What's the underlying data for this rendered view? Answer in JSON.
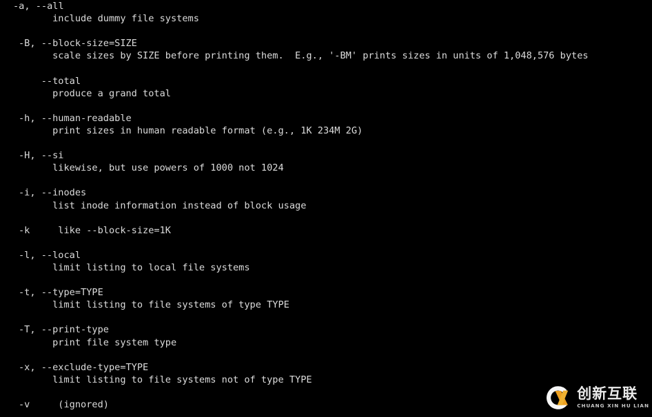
{
  "terminal": {
    "background_color": "#000000",
    "text_color": "#dcdcdc",
    "lines": [
      {
        "indent": "option",
        "text": "-a, --all"
      },
      {
        "indent": "description",
        "text": "      include dummy file systems"
      },
      {
        "indent": "blank",
        "text": ""
      },
      {
        "indent": "option",
        "text": "-B, --block-size=SIZE"
      },
      {
        "indent": "description",
        "text": "      scale sizes by SIZE before printing them.  E.g., '-BM' prints sizes in units of 1,048,576 bytes"
      },
      {
        "indent": "blank",
        "text": ""
      },
      {
        "indent": "option",
        "text": "    --total"
      },
      {
        "indent": "description",
        "text": "      produce a grand total"
      },
      {
        "indent": "blank",
        "text": ""
      },
      {
        "indent": "option",
        "text": "-h, --human-readable"
      },
      {
        "indent": "description",
        "text": "      print sizes in human readable format (e.g., 1K 234M 2G)"
      },
      {
        "indent": "blank",
        "text": ""
      },
      {
        "indent": "option",
        "text": "-H, --si"
      },
      {
        "indent": "description",
        "text": "      likewise, but use powers of 1000 not 1024"
      },
      {
        "indent": "blank",
        "text": ""
      },
      {
        "indent": "option",
        "text": "-i, --inodes"
      },
      {
        "indent": "description",
        "text": "      list inode information instead of block usage"
      },
      {
        "indent": "blank",
        "text": ""
      },
      {
        "indent": "option",
        "text": "-k     like --block-size=1K"
      },
      {
        "indent": "blank",
        "text": ""
      },
      {
        "indent": "option",
        "text": "-l, --local"
      },
      {
        "indent": "description",
        "text": "      limit listing to local file systems"
      },
      {
        "indent": "blank",
        "text": ""
      },
      {
        "indent": "option",
        "text": "-t, --type=TYPE"
      },
      {
        "indent": "description",
        "text": "      limit listing to file systems of type TYPE"
      },
      {
        "indent": "blank",
        "text": ""
      },
      {
        "indent": "option",
        "text": "-T, --print-type"
      },
      {
        "indent": "description",
        "text": "      print file system type"
      },
      {
        "indent": "blank",
        "text": ""
      },
      {
        "indent": "option",
        "text": "-x, --exclude-type=TYPE"
      },
      {
        "indent": "description",
        "text": "      limit listing to file systems not of type TYPE"
      },
      {
        "indent": "blank",
        "text": ""
      },
      {
        "indent": "option",
        "text": "-v     (ignored)"
      }
    ]
  },
  "watermark": {
    "cn_name": "创新互联",
    "pinyin": "CHUANG XIN HU LIAN",
    "mark_ring_color": "#ffffff",
    "mark_x_color": "#f5a623"
  }
}
